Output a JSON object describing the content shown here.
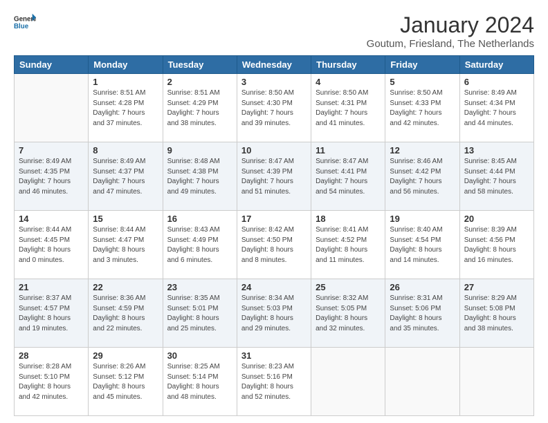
{
  "logo": {
    "line1": "General",
    "line2": "Blue"
  },
  "title": "January 2024",
  "subtitle": "Goutum, Friesland, The Netherlands",
  "weekdays": [
    "Sunday",
    "Monday",
    "Tuesday",
    "Wednesday",
    "Thursday",
    "Friday",
    "Saturday"
  ],
  "weeks": [
    [
      {
        "date": "",
        "sunrise": "",
        "sunset": "",
        "daylight": ""
      },
      {
        "date": "1",
        "sunrise": "Sunrise: 8:51 AM",
        "sunset": "Sunset: 4:28 PM",
        "daylight": "Daylight: 7 hours and 37 minutes."
      },
      {
        "date": "2",
        "sunrise": "Sunrise: 8:51 AM",
        "sunset": "Sunset: 4:29 PM",
        "daylight": "Daylight: 7 hours and 38 minutes."
      },
      {
        "date": "3",
        "sunrise": "Sunrise: 8:50 AM",
        "sunset": "Sunset: 4:30 PM",
        "daylight": "Daylight: 7 hours and 39 minutes."
      },
      {
        "date": "4",
        "sunrise": "Sunrise: 8:50 AM",
        "sunset": "Sunset: 4:31 PM",
        "daylight": "Daylight: 7 hours and 41 minutes."
      },
      {
        "date": "5",
        "sunrise": "Sunrise: 8:50 AM",
        "sunset": "Sunset: 4:33 PM",
        "daylight": "Daylight: 7 hours and 42 minutes."
      },
      {
        "date": "6",
        "sunrise": "Sunrise: 8:49 AM",
        "sunset": "Sunset: 4:34 PM",
        "daylight": "Daylight: 7 hours and 44 minutes."
      }
    ],
    [
      {
        "date": "7",
        "sunrise": "Sunrise: 8:49 AM",
        "sunset": "Sunset: 4:35 PM",
        "daylight": "Daylight: 7 hours and 46 minutes."
      },
      {
        "date": "8",
        "sunrise": "Sunrise: 8:49 AM",
        "sunset": "Sunset: 4:37 PM",
        "daylight": "Daylight: 7 hours and 47 minutes."
      },
      {
        "date": "9",
        "sunrise": "Sunrise: 8:48 AM",
        "sunset": "Sunset: 4:38 PM",
        "daylight": "Daylight: 7 hours and 49 minutes."
      },
      {
        "date": "10",
        "sunrise": "Sunrise: 8:47 AM",
        "sunset": "Sunset: 4:39 PM",
        "daylight": "Daylight: 7 hours and 51 minutes."
      },
      {
        "date": "11",
        "sunrise": "Sunrise: 8:47 AM",
        "sunset": "Sunset: 4:41 PM",
        "daylight": "Daylight: 7 hours and 54 minutes."
      },
      {
        "date": "12",
        "sunrise": "Sunrise: 8:46 AM",
        "sunset": "Sunset: 4:42 PM",
        "daylight": "Daylight: 7 hours and 56 minutes."
      },
      {
        "date": "13",
        "sunrise": "Sunrise: 8:45 AM",
        "sunset": "Sunset: 4:44 PM",
        "daylight": "Daylight: 7 hours and 58 minutes."
      }
    ],
    [
      {
        "date": "14",
        "sunrise": "Sunrise: 8:44 AM",
        "sunset": "Sunset: 4:45 PM",
        "daylight": "Daylight: 8 hours and 0 minutes."
      },
      {
        "date": "15",
        "sunrise": "Sunrise: 8:44 AM",
        "sunset": "Sunset: 4:47 PM",
        "daylight": "Daylight: 8 hours and 3 minutes."
      },
      {
        "date": "16",
        "sunrise": "Sunrise: 8:43 AM",
        "sunset": "Sunset: 4:49 PM",
        "daylight": "Daylight: 8 hours and 6 minutes."
      },
      {
        "date": "17",
        "sunrise": "Sunrise: 8:42 AM",
        "sunset": "Sunset: 4:50 PM",
        "daylight": "Daylight: 8 hours and 8 minutes."
      },
      {
        "date": "18",
        "sunrise": "Sunrise: 8:41 AM",
        "sunset": "Sunset: 4:52 PM",
        "daylight": "Daylight: 8 hours and 11 minutes."
      },
      {
        "date": "19",
        "sunrise": "Sunrise: 8:40 AM",
        "sunset": "Sunset: 4:54 PM",
        "daylight": "Daylight: 8 hours and 14 minutes."
      },
      {
        "date": "20",
        "sunrise": "Sunrise: 8:39 AM",
        "sunset": "Sunset: 4:56 PM",
        "daylight": "Daylight: 8 hours and 16 minutes."
      }
    ],
    [
      {
        "date": "21",
        "sunrise": "Sunrise: 8:37 AM",
        "sunset": "Sunset: 4:57 PM",
        "daylight": "Daylight: 8 hours and 19 minutes."
      },
      {
        "date": "22",
        "sunrise": "Sunrise: 8:36 AM",
        "sunset": "Sunset: 4:59 PM",
        "daylight": "Daylight: 8 hours and 22 minutes."
      },
      {
        "date": "23",
        "sunrise": "Sunrise: 8:35 AM",
        "sunset": "Sunset: 5:01 PM",
        "daylight": "Daylight: 8 hours and 25 minutes."
      },
      {
        "date": "24",
        "sunrise": "Sunrise: 8:34 AM",
        "sunset": "Sunset: 5:03 PM",
        "daylight": "Daylight: 8 hours and 29 minutes."
      },
      {
        "date": "25",
        "sunrise": "Sunrise: 8:32 AM",
        "sunset": "Sunset: 5:05 PM",
        "daylight": "Daylight: 8 hours and 32 minutes."
      },
      {
        "date": "26",
        "sunrise": "Sunrise: 8:31 AM",
        "sunset": "Sunset: 5:06 PM",
        "daylight": "Daylight: 8 hours and 35 minutes."
      },
      {
        "date": "27",
        "sunrise": "Sunrise: 8:29 AM",
        "sunset": "Sunset: 5:08 PM",
        "daylight": "Daylight: 8 hours and 38 minutes."
      }
    ],
    [
      {
        "date": "28",
        "sunrise": "Sunrise: 8:28 AM",
        "sunset": "Sunset: 5:10 PM",
        "daylight": "Daylight: 8 hours and 42 minutes."
      },
      {
        "date": "29",
        "sunrise": "Sunrise: 8:26 AM",
        "sunset": "Sunset: 5:12 PM",
        "daylight": "Daylight: 8 hours and 45 minutes."
      },
      {
        "date": "30",
        "sunrise": "Sunrise: 8:25 AM",
        "sunset": "Sunset: 5:14 PM",
        "daylight": "Daylight: 8 hours and 48 minutes."
      },
      {
        "date": "31",
        "sunrise": "Sunrise: 8:23 AM",
        "sunset": "Sunset: 5:16 PM",
        "daylight": "Daylight: 8 hours and 52 minutes."
      },
      {
        "date": "",
        "sunrise": "",
        "sunset": "",
        "daylight": ""
      },
      {
        "date": "",
        "sunrise": "",
        "sunset": "",
        "daylight": ""
      },
      {
        "date": "",
        "sunrise": "",
        "sunset": "",
        "daylight": ""
      }
    ]
  ]
}
